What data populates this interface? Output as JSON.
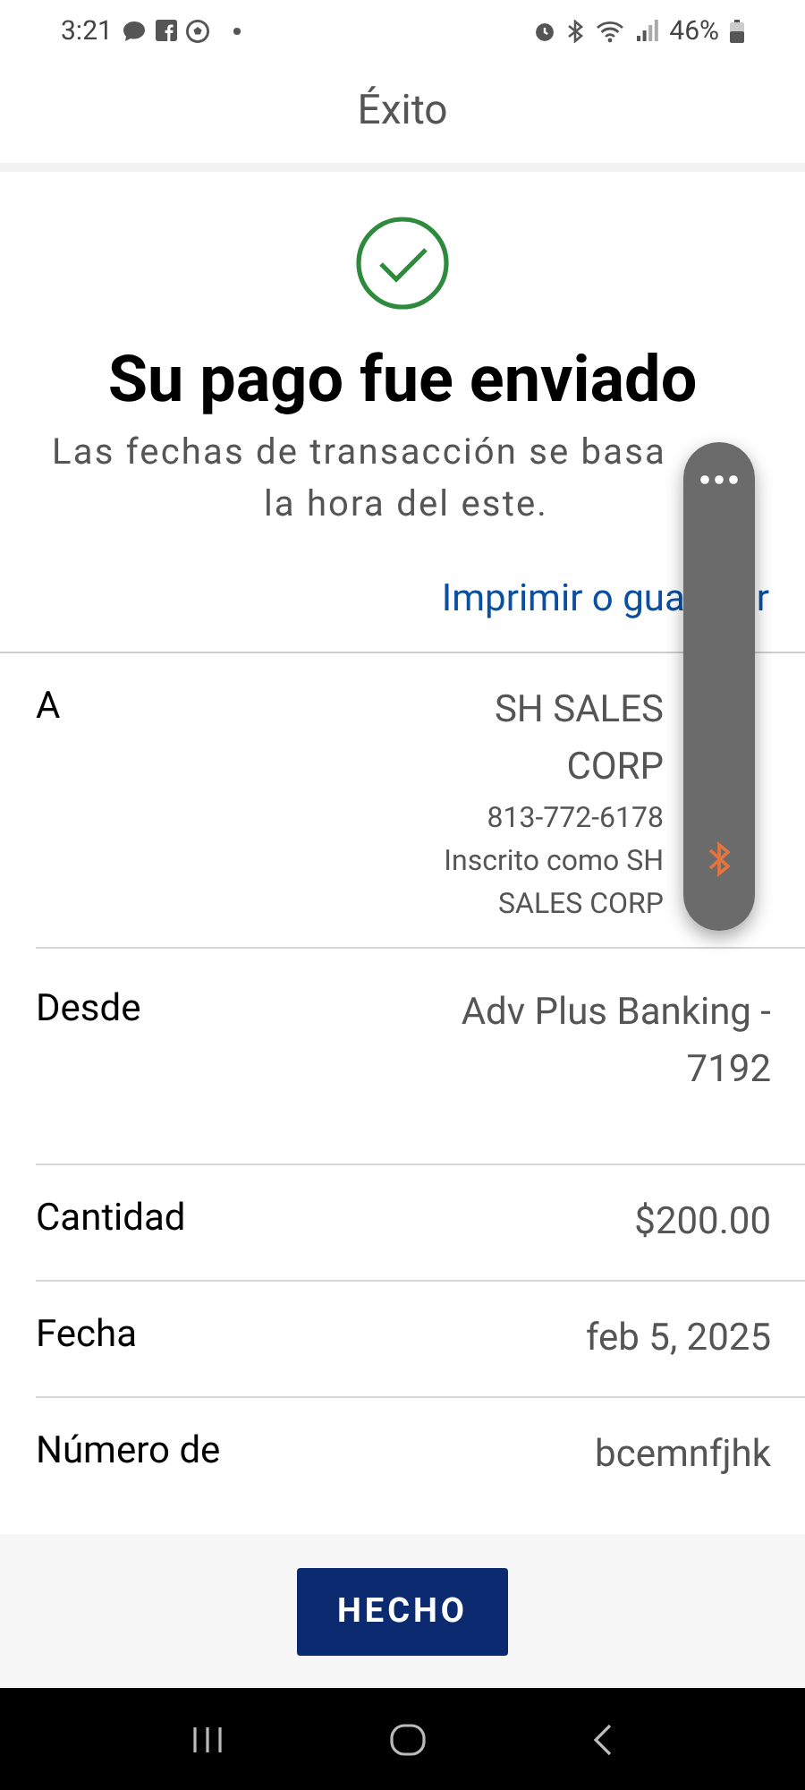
{
  "status_bar": {
    "time": "3:21",
    "battery": "46%"
  },
  "header": {
    "title": "Éxito"
  },
  "confirmation": {
    "heading": "Su pago fue enviado",
    "note_lines": [
      "Las fechas de transacción se basa",
      "la hora del este."
    ],
    "link_before_overlay": "Imprimir o gua",
    "link_after_overlay": "r"
  },
  "details": [
    {
      "label": "A",
      "values": [
        "SH SALES",
        "CORP"
      ],
      "subvalues": [
        "813-772-6178",
        "Inscrito como SH",
        "SALES CORP"
      ],
      "kind": "payee"
    },
    {
      "label": "Desde",
      "values": [
        "Adv Plus Banking -",
        "7192"
      ],
      "kind": "plain"
    },
    {
      "label": "Cantidad",
      "values": [
        "$200.00"
      ],
      "kind": "plain"
    },
    {
      "label": "Fecha",
      "values": [
        "feb 5, 2025"
      ],
      "kind": "plain"
    },
    {
      "label": "Número de",
      "values": [
        "bcemnfjhk"
      ],
      "kind": "plain"
    }
  ],
  "footer": {
    "button": "HECHO"
  }
}
